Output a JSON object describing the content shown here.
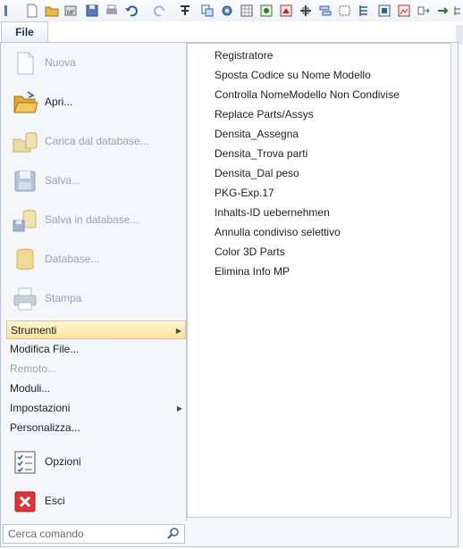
{
  "toolbar": {
    "icons": [
      "new-file-icon",
      "open-folder-icon",
      "save-icon",
      "print-icon",
      "undo-icon",
      "redo-icon",
      "tool-icon",
      "copy-icon",
      "settings-gear-icon",
      "grid-icon",
      "node-icon",
      "component-icon",
      "frame-icon",
      "align-icon",
      "box-icon",
      "image-icon",
      "arrow-tool-icon",
      "tree-icon"
    ]
  },
  "file_tab": {
    "label": "File"
  },
  "left_menu": {
    "big_items": [
      {
        "label": "Nuova",
        "icon": "new-document-icon",
        "enabled": false
      },
      {
        "label": "Apri...",
        "icon": "open-folder-icon",
        "enabled": true
      },
      {
        "label": "Carica dal database...",
        "icon": "load-from-database-icon",
        "enabled": false
      },
      {
        "label": "Salva...",
        "icon": "save-disk-icon",
        "enabled": false
      },
      {
        "label": "Salva in database...",
        "icon": "save-to-database-icon",
        "enabled": false
      },
      {
        "label": "Database...",
        "icon": "database-icon",
        "enabled": false
      },
      {
        "label": "Stampa",
        "icon": "printer-icon",
        "enabled": false
      }
    ],
    "small_items": [
      {
        "label": "Strumenti",
        "submenu": true,
        "enabled": true,
        "selected": true
      },
      {
        "label": "Modifica File...",
        "submenu": false,
        "enabled": true
      },
      {
        "label": "Remoto...",
        "submenu": false,
        "enabled": false
      },
      {
        "label": "Moduli...",
        "submenu": false,
        "enabled": true
      },
      {
        "label": "Impostazioni",
        "submenu": true,
        "enabled": true
      },
      {
        "label": "Personalizza...",
        "submenu": false,
        "enabled": true
      }
    ],
    "bottom_items": [
      {
        "label": "Opzioni",
        "icon": "options-checklist-icon"
      },
      {
        "label": "Esci",
        "icon": "exit-icon"
      }
    ]
  },
  "submenu": {
    "items": [
      "Registratore",
      "Sposta Codice su Nome Modello",
      "Controlla NomeModello Non Condivise",
      "Replace Parts/Assys",
      "Densita_Assegna",
      "Densita_Trova parti",
      "Densita_Dal peso",
      "PKG-Exp.17",
      "Inhalts-ID uebernehmen",
      "Annulla condiviso selettivo",
      "Color 3D Parts",
      "Elimina Info MP"
    ]
  },
  "search": {
    "placeholder": "Cerca comando"
  },
  "colors": {
    "highlight": "#fbe39a",
    "disabled_text": "#9aa1ab"
  }
}
